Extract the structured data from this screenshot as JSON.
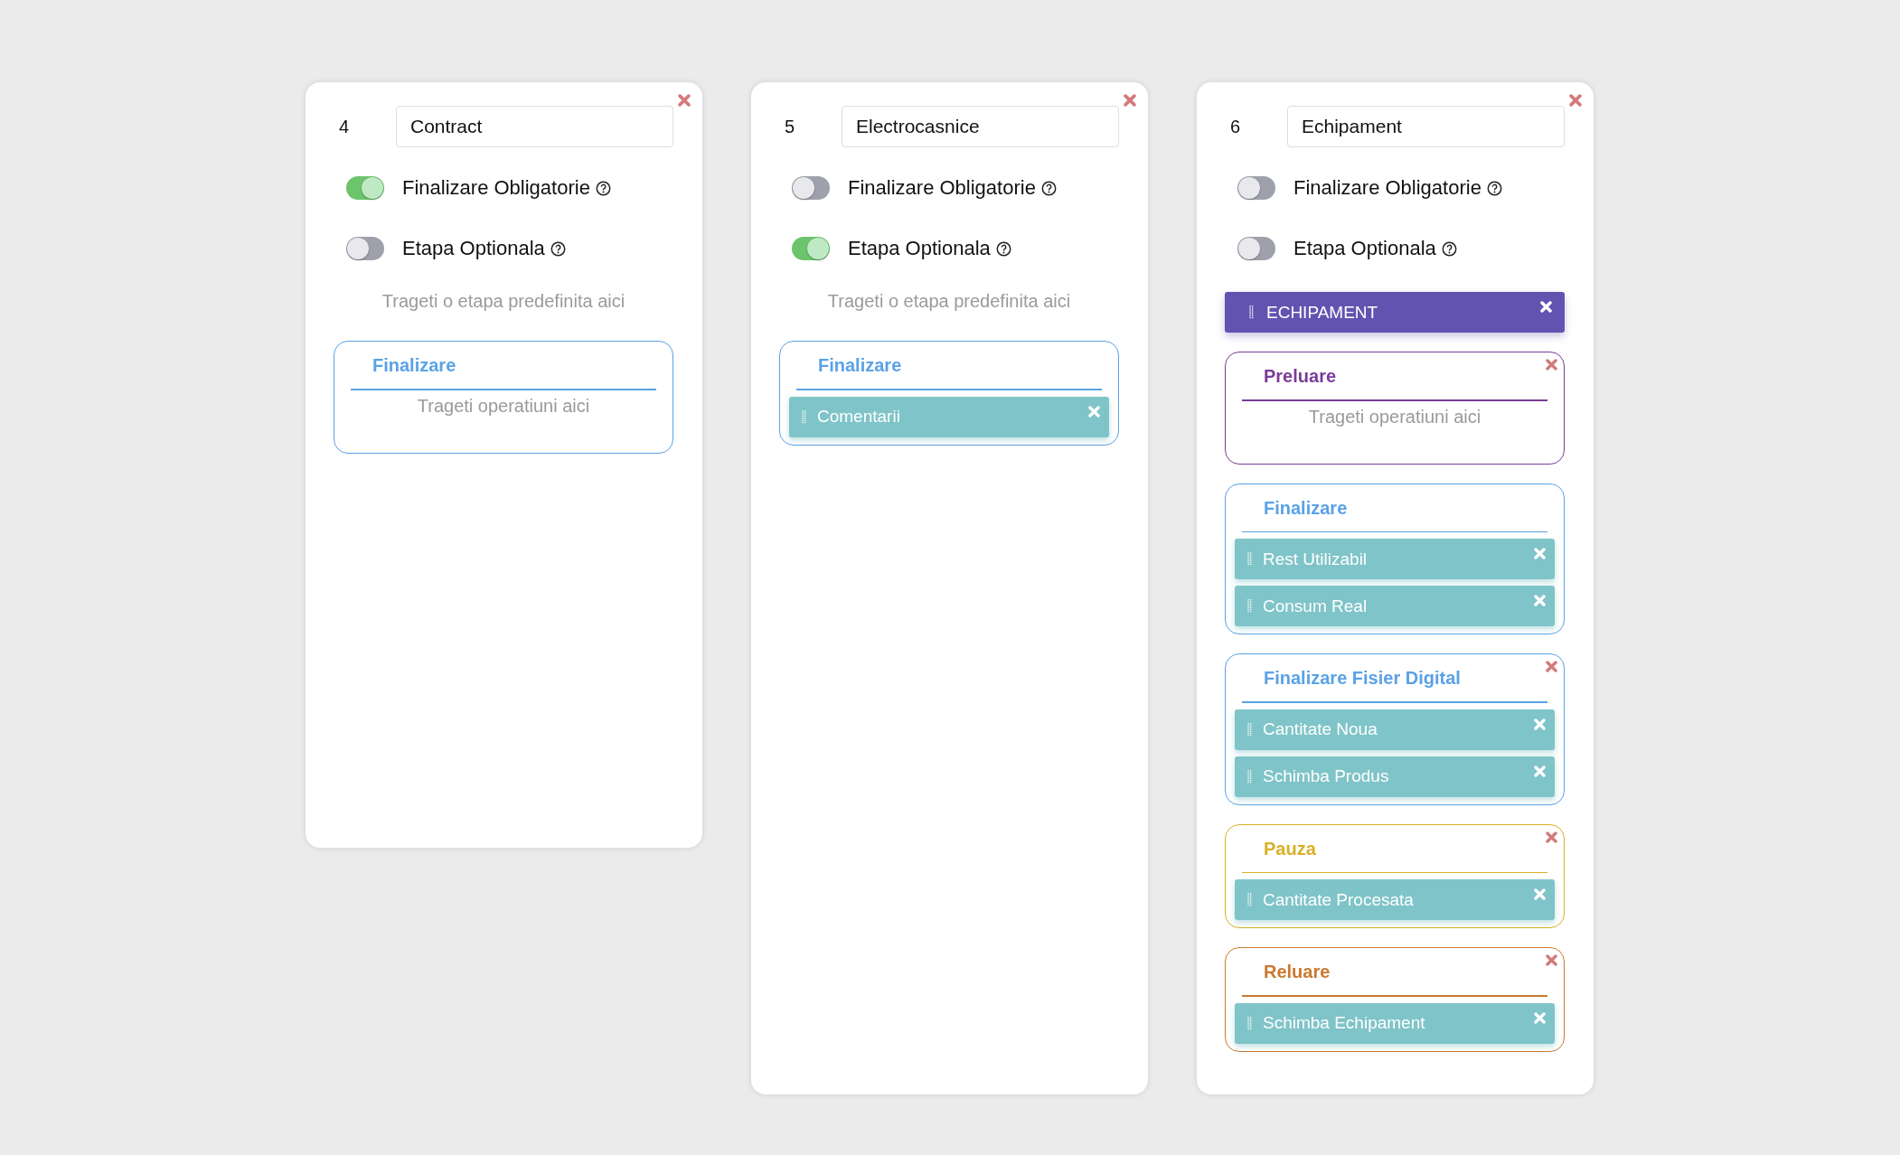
{
  "cards": [
    {
      "number": "4",
      "name": "Contract",
      "toggles": [
        {
          "label": "Finalizare Obligatorie",
          "on": true
        },
        {
          "label": "Etapa Optionala",
          "on": false
        }
      ],
      "stage_hint": "Trageti o etapa predefinita aici",
      "groups": [
        {
          "title": "Finalizare",
          "color": "#5aa2e6",
          "removable": false,
          "operations_hint": "Trageti operatiuni aici"
        }
      ]
    },
    {
      "number": "5",
      "name": "Electrocasnice",
      "toggles": [
        {
          "label": "Finalizare Obligatorie",
          "on": false
        },
        {
          "label": "Etapa Optionala",
          "on": true
        }
      ],
      "stage_hint": "Trageti o etapa predefinita aici",
      "groups": [
        {
          "title": "Finalizare",
          "color": "#5aa2e6",
          "removable": false,
          "operations": [
            "Comentarii"
          ]
        }
      ]
    },
    {
      "number": "6",
      "name": "Echipament",
      "toggles": [
        {
          "label": "Finalizare Obligatorie",
          "on": false
        },
        {
          "label": "Etapa Optionala",
          "on": false
        }
      ],
      "stage": "ECHIPAMENT",
      "groups": [
        {
          "title": "Preluare",
          "color": "#7a3c98",
          "removable": true,
          "operations_hint": "Trageti operatiuni aici"
        },
        {
          "title": "Finalizare",
          "color": "#5aa2e6",
          "removable": false,
          "operations": [
            "Rest Utilizabil",
            "Consum Real"
          ]
        },
        {
          "title": "Finalizare Fisier Digital",
          "color": "#5aa2e6",
          "removable": true,
          "operations": [
            "Cantitate Noua",
            "Schimba Produs"
          ]
        },
        {
          "title": "Pauza",
          "color": "#d8b026",
          "removable": true,
          "operations": [
            "Cantitate Procesata"
          ]
        },
        {
          "title": "Reluare",
          "color": "#c97a30",
          "removable": true,
          "operations": [
            "Schimba Echipament"
          ]
        }
      ]
    }
  ]
}
